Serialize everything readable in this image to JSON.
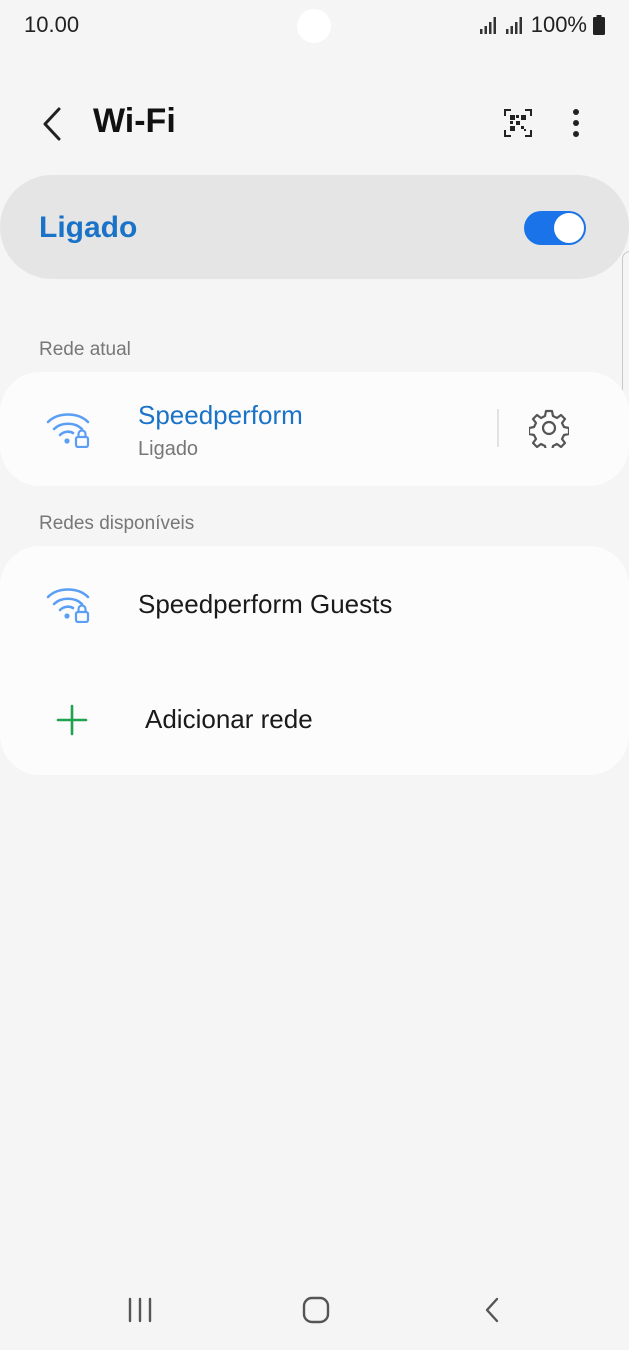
{
  "status_bar": {
    "time": "10.00",
    "battery": "100%",
    "icons": [
      "signal-icon",
      "signal-icon",
      "battery-icon"
    ]
  },
  "header": {
    "title": "Wi-Fi",
    "back_icon": "back-arrow-icon",
    "qr_icon": "qr-scan-icon",
    "more_icon": "more-vertical-icon"
  },
  "master_toggle": {
    "label": "Ligado",
    "state": "on"
  },
  "current_network": {
    "section_label": "Rede atual",
    "name": "Speedperform",
    "status": "Ligado",
    "icon": "wifi-lock-icon",
    "settings_icon": "gear-icon"
  },
  "available_networks": {
    "section_label": "Redes disponíveis",
    "items": [
      {
        "name": "Speedperform Guests",
        "icon": "wifi-lock-icon"
      }
    ],
    "add_network_label": "Adicionar rede",
    "add_icon": "plus-icon"
  },
  "nav_bar": {
    "buttons": [
      "recents-icon",
      "home-icon",
      "back-icon"
    ]
  },
  "colors": {
    "accent": "#1a73e8",
    "accent_text": "#1a73c7",
    "wifi_icon": "#5a9ff5",
    "add_icon": "#1fa350",
    "background": "#f5f5f5"
  }
}
